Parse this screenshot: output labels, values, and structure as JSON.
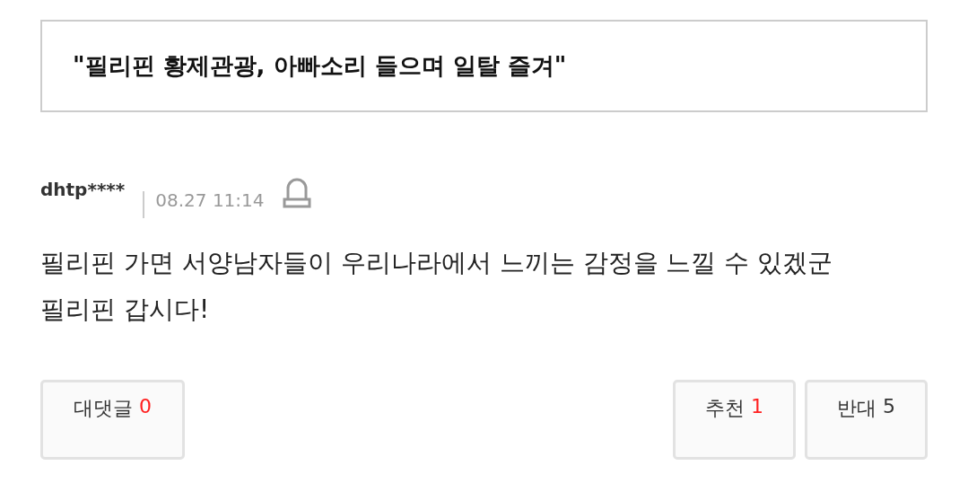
{
  "headline": "\"필리핀 황제관광, 아빠소리 들으며 일탈 즐겨\"",
  "comment": {
    "user": "dhtp****",
    "time": "08.27 11:14",
    "lines": [
      "필리핀 가면 서양남자들이 우리나라에서 느끼는 감정을 느낄 수 있겠군",
      "필리핀 갑시다!"
    ]
  },
  "buttons": [
    {
      "kind": "reply",
      "label": "대댓글",
      "count": "0",
      "color": "#ff2020"
    },
    {
      "kind": "vote",
      "label": "추천",
      "count": "1",
      "color": "#ff2020"
    },
    {
      "kind": "vote",
      "label": "반대",
      "count": "5",
      "color": "#333333"
    }
  ]
}
